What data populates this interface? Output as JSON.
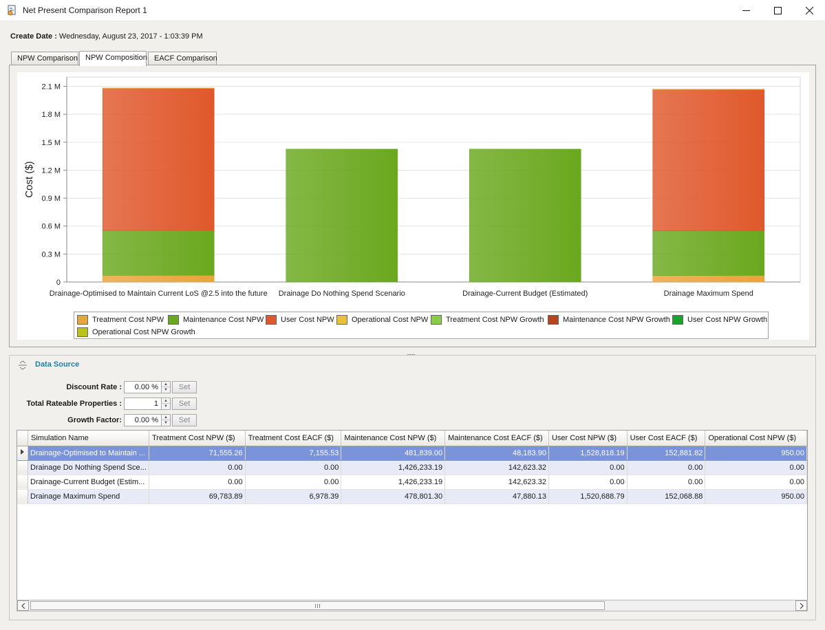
{
  "window": {
    "title": "Net Present Comparison Report 1",
    "minimize_glyph": "—",
    "maximize_glyph": "☐",
    "close_glyph": "✕"
  },
  "header": {
    "create_date_label": "Create Date :",
    "create_date_value": "Wednesday, August 23, 2017 - 1:03:39 PM"
  },
  "tabs": [
    {
      "label": "NPW Comparison",
      "active": false
    },
    {
      "label": "NPW Composition",
      "active": true
    },
    {
      "label": "EACF Comparison",
      "active": false
    }
  ],
  "chart_data": {
    "type": "bar",
    "stacked": true,
    "ylabel": "Cost ($)",
    "ylim": [
      0,
      2200000
    ],
    "yticks": [
      "0",
      "0.3 M",
      "0.6 M",
      "0.9 M",
      "1.2 M",
      "1.5 M",
      "1.8 M",
      "2.1 M"
    ],
    "ytick_values": [
      0,
      300000,
      600000,
      900000,
      1200000,
      1500000,
      1800000,
      2100000
    ],
    "grid": true,
    "legend_position": "bottom",
    "categories": [
      "Drainage-Optimised to Maintain Current LoS @2.5 into the future",
      "Drainage Do Nothing Spend Scenario",
      "Drainage-Current Budget (Estimated)",
      "Drainage Maximum Spend"
    ],
    "series": [
      {
        "name": "Treatment Cost NPW",
        "color": "#e8a53a",
        "values": [
          71555.26,
          0,
          0,
          69783.89
        ]
      },
      {
        "name": "Maintenance Cost NPW",
        "color": "#6aa81e",
        "values": [
          481839.0,
          1426233.19,
          1426233.19,
          478801.3
        ]
      },
      {
        "name": "User Cost NPW",
        "color": "#e0582c",
        "values": [
          1528818.19,
          0,
          0,
          1520688.79
        ]
      },
      {
        "name": "Operational Cost NPW",
        "color": "#e8c23a",
        "values": [
          950.0,
          0,
          0,
          950.0
        ]
      },
      {
        "name": "Treatment Cost NPW Growth",
        "color": "#86cf44",
        "values": [
          0,
          0,
          0,
          0
        ]
      },
      {
        "name": "Maintenance Cost NPW Growth",
        "color": "#b8441e",
        "values": [
          0,
          0,
          0,
          0
        ]
      },
      {
        "name": "User Cost NPW Growth",
        "color": "#1aa52a",
        "values": [
          0,
          0,
          0,
          0
        ]
      },
      {
        "name": "Operational Cost NPW Growth",
        "color": "#bcc21a",
        "values": [
          0,
          0,
          0,
          0
        ]
      }
    ]
  },
  "data_source": {
    "title": "Data Source",
    "params": [
      {
        "label": "Discount Rate :",
        "value": "0.00 %",
        "button": "Set"
      },
      {
        "label": "Total Rateable Properties :",
        "value": "1",
        "button": "Set"
      },
      {
        "label": "Growth Factor:",
        "value": "0.00 %",
        "button": "Set"
      }
    ],
    "columns": [
      "Simulation Name",
      "Treatment Cost NPW ($)",
      "Treatment Cost EACF ($)",
      "Maintenance Cost NPW ($)",
      "Maintenance Cost EACF ($)",
      "User Cost NPW ($)",
      "User Cost EACF ($)",
      "Operational Cost NPW ($)"
    ],
    "rows": [
      [
        "Drainage-Optimised to Maintain ...",
        "71,555.26",
        "7,155.53",
        "481,839.00",
        "48,183.90",
        "1,528,818.19",
        "152,881.82",
        "950.00"
      ],
      [
        "Drainage Do Nothing Spend Sce...",
        "0.00",
        "0.00",
        "1,426,233.19",
        "142,623.32",
        "0.00",
        "0.00",
        "0.00"
      ],
      [
        "Drainage-Current Budget (Estim...",
        "0.00",
        "0.00",
        "1,426,233.19",
        "142,623.32",
        "0.00",
        "0.00",
        "0.00"
      ],
      [
        "Drainage Maximum Spend",
        "69,783.89",
        "6,978.39",
        "478,801.30",
        "47,880.13",
        "1,520,688.79",
        "152,068.88",
        "950.00"
      ]
    ],
    "selected_row": 0
  }
}
